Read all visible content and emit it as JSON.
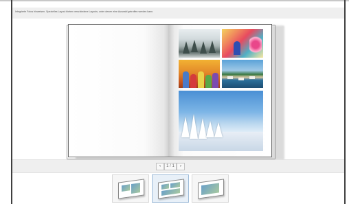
{
  "hint": {
    "text": "Integrierte Fotos hinweisen. Spezielles Layout bieten verschiedene Layouts, unter denen eine Auswahl getroffen werden kann."
  },
  "book": {
    "photos": [
      {
        "name": "snow-forest-photo"
      },
      {
        "name": "colorful-houses-photo"
      },
      {
        "name": "autumn-family-photo"
      },
      {
        "name": "harbor-photo"
      },
      {
        "name": "winter-landscape-photo"
      }
    ]
  },
  "navigation": {
    "prev_label": "‹",
    "page_label": "1 / 1",
    "next_label": "›"
  },
  "layouts": [
    {
      "icon": "layout-thumbnail-1",
      "selected": false
    },
    {
      "icon": "layout-thumbnail-2",
      "selected": true
    },
    {
      "icon": "layout-thumbnail-3",
      "selected": false
    }
  ]
}
